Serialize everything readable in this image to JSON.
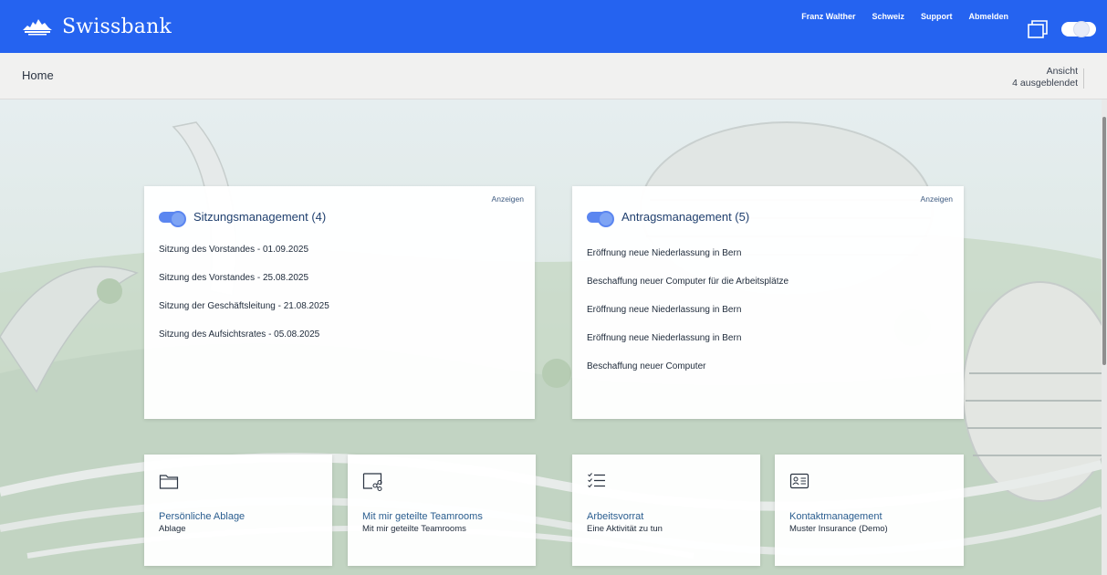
{
  "header": {
    "brand": "Swissbank",
    "nav": [
      "Franz Walther",
      "Schweiz",
      "Support",
      "Abmelden"
    ]
  },
  "subbar": {
    "breadcrumb": "Home",
    "view_label": "Ansicht",
    "hidden_label": "4 ausgeblendet"
  },
  "cards": {
    "meetings": {
      "show": "Anzeigen",
      "title": "Sitzungsmanagement (4)",
      "items": [
        "Sitzung des Vorstandes - 01.09.2025",
        "Sitzung des Vorstandes - 25.08.2025",
        "Sitzung der Geschäftsleitung - 21.08.2025",
        "Sitzung des Aufsichtsrates - 05.08.2025"
      ]
    },
    "requests": {
      "show": "Anzeigen",
      "title": "Antragsmanagement (5)",
      "items": [
        "Eröffnung neue Niederlassung in Bern",
        "Beschaffung neuer Computer für die Arbeitsplätze",
        "Eröffnung neue Niederlassung in Bern",
        "Eröffnung neue Niederlassung in Bern",
        "Beschaffung neuer Computer"
      ]
    }
  },
  "tiles": [
    {
      "icon": "folder-icon",
      "title": "Persönliche Ablage",
      "subtitle": "Ablage"
    },
    {
      "icon": "shared-teamroom-icon",
      "title": "Mit mir geteilte Teamrooms",
      "subtitle": "Mit mir geteilte Teamrooms"
    },
    {
      "icon": "checklist-icon",
      "title": "Arbeitsvorrat",
      "subtitle": "Eine Aktivität zu tun"
    },
    {
      "icon": "contact-card-icon",
      "title": "Kontaktmanagement",
      "subtitle": "Muster Insurance (Demo)"
    }
  ],
  "colors": {
    "header_blue": "#2563f0",
    "title_blue": "#1f3f6e",
    "link_blue": "#2a5d8f"
  }
}
